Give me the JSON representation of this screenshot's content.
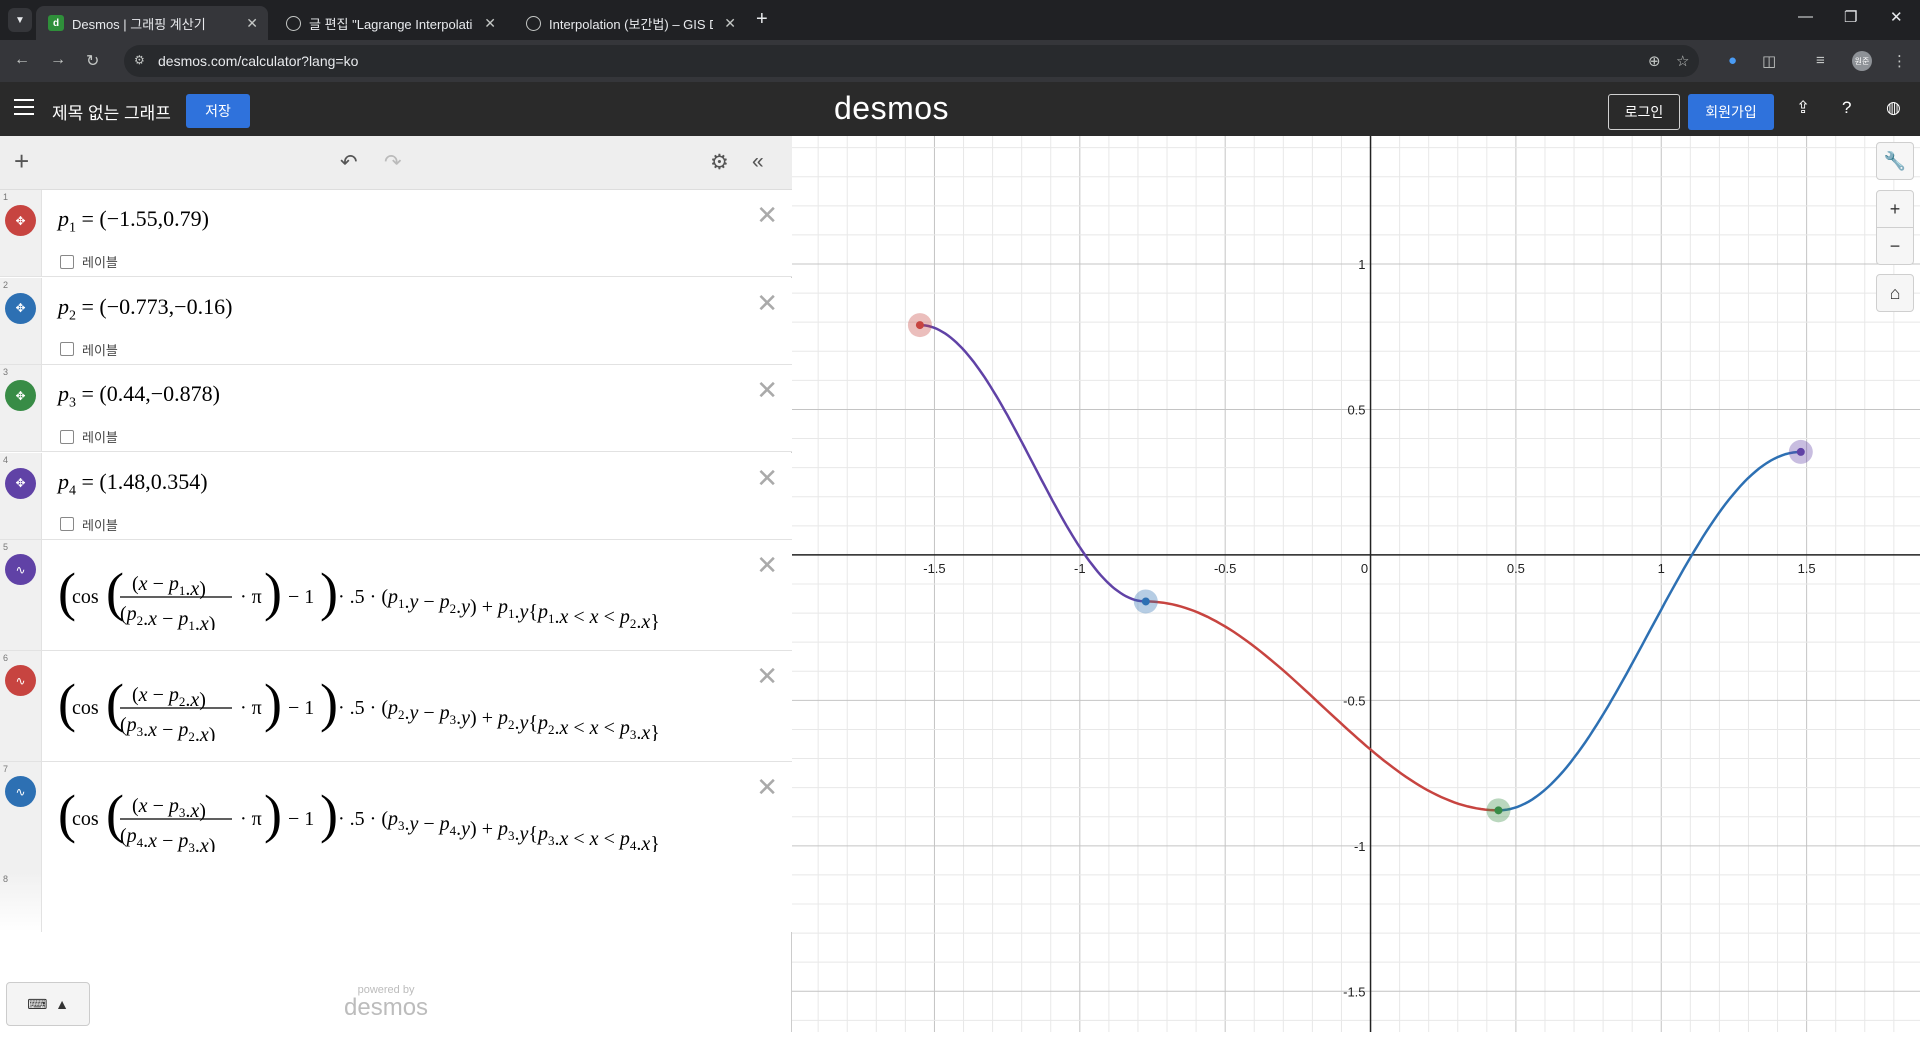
{
  "browser": {
    "tabs": [
      {
        "title": "Desmos | 그래핑 계산기",
        "active": true
      },
      {
        "title": "글 편집 \"Lagrange Interpolation\"",
        "active": false
      },
      {
        "title": "Interpolation (보간법) – GIS Developer",
        "active": false
      }
    ],
    "url": "desmos.com/calculator?lang=ko",
    "profile_initials": "원준"
  },
  "header": {
    "title": "제목 없는 그래프",
    "save_label": "저장",
    "brand": "desmos",
    "login_label": "로그인",
    "signup_label": "회원가입"
  },
  "expressions": {
    "label_text": "레이블",
    "points": [
      {
        "index": "1",
        "name": "p",
        "sub": "1",
        "value": "(−1.55,0.79)",
        "x": -1.55,
        "y": 0.79,
        "color": "#c74440"
      },
      {
        "index": "2",
        "name": "p",
        "sub": "2",
        "value": "(−0.773,−0.16)",
        "x": -0.773,
        "y": -0.16,
        "color": "#2d70b3"
      },
      {
        "index": "3",
        "name": "p",
        "sub": "3",
        "value": "(0.44,−0.878)",
        "x": 0.44,
        "y": -0.878,
        "color": "#388c46"
      },
      {
        "index": "4",
        "name": "p",
        "sub": "4",
        "value": "(1.48,0.354)",
        "x": 1.48,
        "y": 0.354,
        "color": "#6042a6"
      }
    ],
    "formulas": [
      {
        "index": "5",
        "a": "1",
        "b": "2",
        "color": "#6042a6"
      },
      {
        "index": "6",
        "a": "2",
        "b": "3",
        "color": "#c74440"
      },
      {
        "index": "7",
        "a": "3",
        "b": "4",
        "color": "#2d70b3"
      }
    ],
    "empty_index": "8",
    "powered_by": "powered by",
    "powered_brand": "desmos"
  },
  "chart_data": {
    "type": "line",
    "xlim": [
      -1.99,
      1.89
    ],
    "ylim": [
      -1.64,
      1.44
    ],
    "x_ticks": [
      "-1.5",
      "-1",
      "-0.5",
      "0",
      "0.5",
      "1",
      "1.5"
    ],
    "y_ticks": [
      "1",
      "0.5",
      "-0.5",
      "-1",
      "-1.5"
    ],
    "grid": true,
    "points": [
      {
        "x": -1.55,
        "y": 0.79,
        "color": "#c74440"
      },
      {
        "x": -0.773,
        "y": -0.16,
        "color": "#2d70b3"
      },
      {
        "x": 0.44,
        "y": -0.878,
        "color": "#388c46"
      },
      {
        "x": 1.48,
        "y": 0.354,
        "color": "#6042a6"
      }
    ],
    "series": [
      {
        "from_x": -1.55,
        "from_y": 0.79,
        "to_x": -0.773,
        "to_y": -0.16,
        "color": "#6042a6"
      },
      {
        "from_x": -0.773,
        "from_y": -0.16,
        "to_x": 0.44,
        "to_y": -0.878,
        "color": "#c74440"
      },
      {
        "from_x": 0.44,
        "from_y": -0.878,
        "to_x": 1.48,
        "to_y": 0.354,
        "color": "#2d70b3"
      }
    ]
  }
}
